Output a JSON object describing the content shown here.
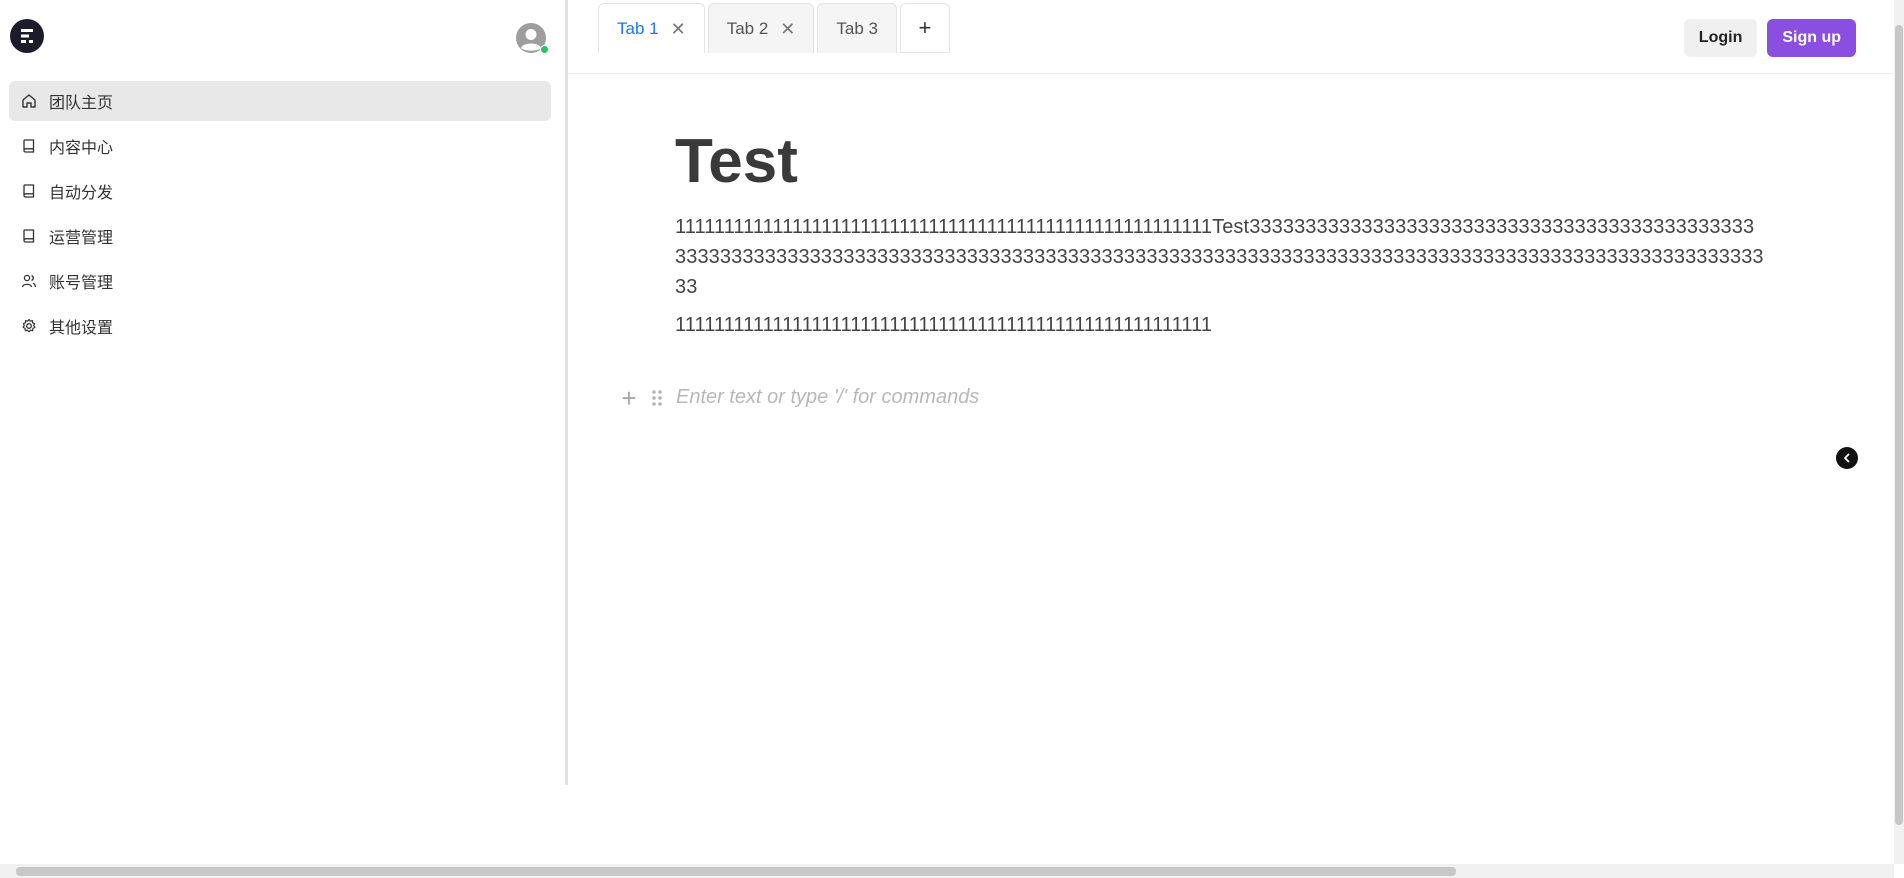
{
  "sidebar": {
    "items": [
      {
        "label": "团队主页",
        "icon": "home-icon",
        "active": true
      },
      {
        "label": "内容中心",
        "icon": "book-icon",
        "active": false
      },
      {
        "label": "自动分发",
        "icon": "book-icon",
        "active": false
      },
      {
        "label": "运营管理",
        "icon": "book-icon",
        "active": false
      },
      {
        "label": "账号管理",
        "icon": "users-icon",
        "active": false
      },
      {
        "label": "其他设置",
        "icon": "gear-icon",
        "active": false
      }
    ]
  },
  "tabs": [
    {
      "label": "Tab 1",
      "active": true,
      "closable": true
    },
    {
      "label": "Tab 2",
      "active": false,
      "closable": true
    },
    {
      "label": "Tab 3",
      "active": false,
      "closable": false
    }
  ],
  "auth": {
    "login_label": "Login",
    "signup_label": "Sign up"
  },
  "document": {
    "title": "Test",
    "paragraphs": [
      "1111111111111111111111111111111111111111111111111111111Test333333333333333333333333333333333333333333333333333333333333333333333333333333333333333333333333333333333333333333333333333333333333333333333333",
      "1111111111111111111111111111111111111111111111111111111"
    ],
    "placeholder": "Enter text or type '/' for commands"
  },
  "colors": {
    "accent": "#1677ff",
    "signup": "#8a4fe0",
    "status_online": "#22c55e"
  }
}
